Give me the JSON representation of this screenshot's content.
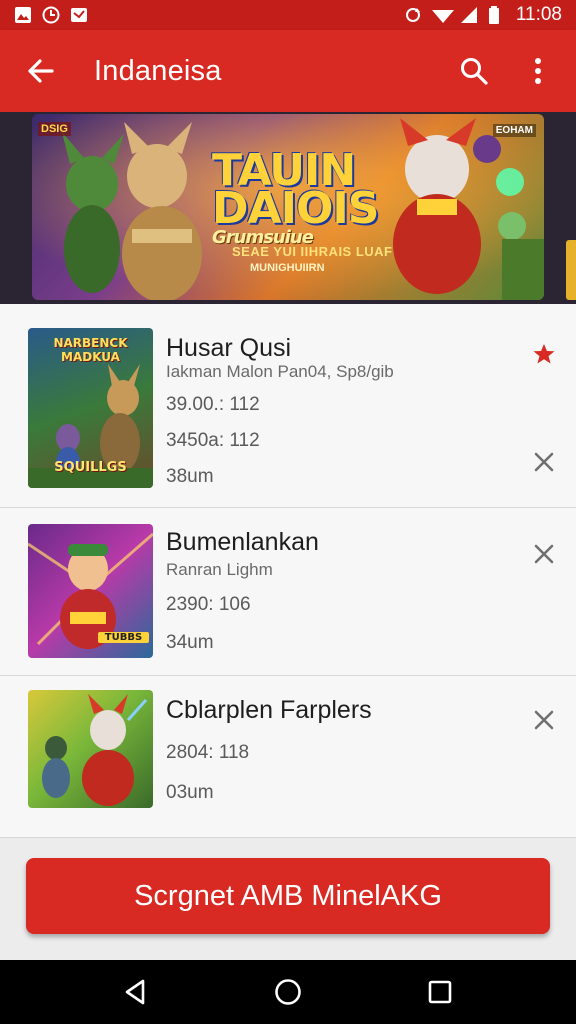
{
  "status_bar": {
    "time": "11:08",
    "left_icons": [
      "photo-icon",
      "clock-icon",
      "mail-icon"
    ],
    "right_icons": [
      "sync-icon",
      "wifi-icon",
      "signal-icon",
      "battery-icon"
    ]
  },
  "app_bar": {
    "title": "Indaneisa",
    "back_icon": "arrow-left-icon",
    "search_icon": "search-icon",
    "menu_icon": "more-vert-icon"
  },
  "banner": {
    "badge_left": "DSIG",
    "badge_right": "EOHAM",
    "title_line1": "TAUIN",
    "title_line2": "DAIOIS",
    "title_line3": "Grumsuiue",
    "sub_line1": "SEAE YUI IIHRAIS LUAF",
    "sub_line2": "MUNIGHUIIRN"
  },
  "items": [
    {
      "thumb_label_top": "NARBENCK MADKUA",
      "thumb_label_bottom": "SQUILLGS",
      "title": "Husar Qusi",
      "subtitle": "Iakman Malon Pan04, Sp8/gib",
      "line1": "39.00.: 112",
      "line2": "3450а: 112",
      "line3": "38um",
      "starred": true
    },
    {
      "thumb_label_bottom": "TUBBS",
      "title": "Bumenlankan",
      "subtitle": "Ranran Lighm",
      "line1": "2390: 106",
      "line2": "34um",
      "starred": false
    },
    {
      "title": "Cblarplen Farplers",
      "line1": "2804: 118",
      "line2": "03um",
      "starred": false
    }
  ],
  "cta": {
    "label": "Scrgnet AMB MinelAKG"
  },
  "colors": {
    "accent": "#d82a22",
    "status": "#c41e1a",
    "star": "#d82a22"
  },
  "nav": {
    "back_icon": "nav-back-icon",
    "home_icon": "nav-home-icon",
    "recents_icon": "nav-recents-icon"
  }
}
